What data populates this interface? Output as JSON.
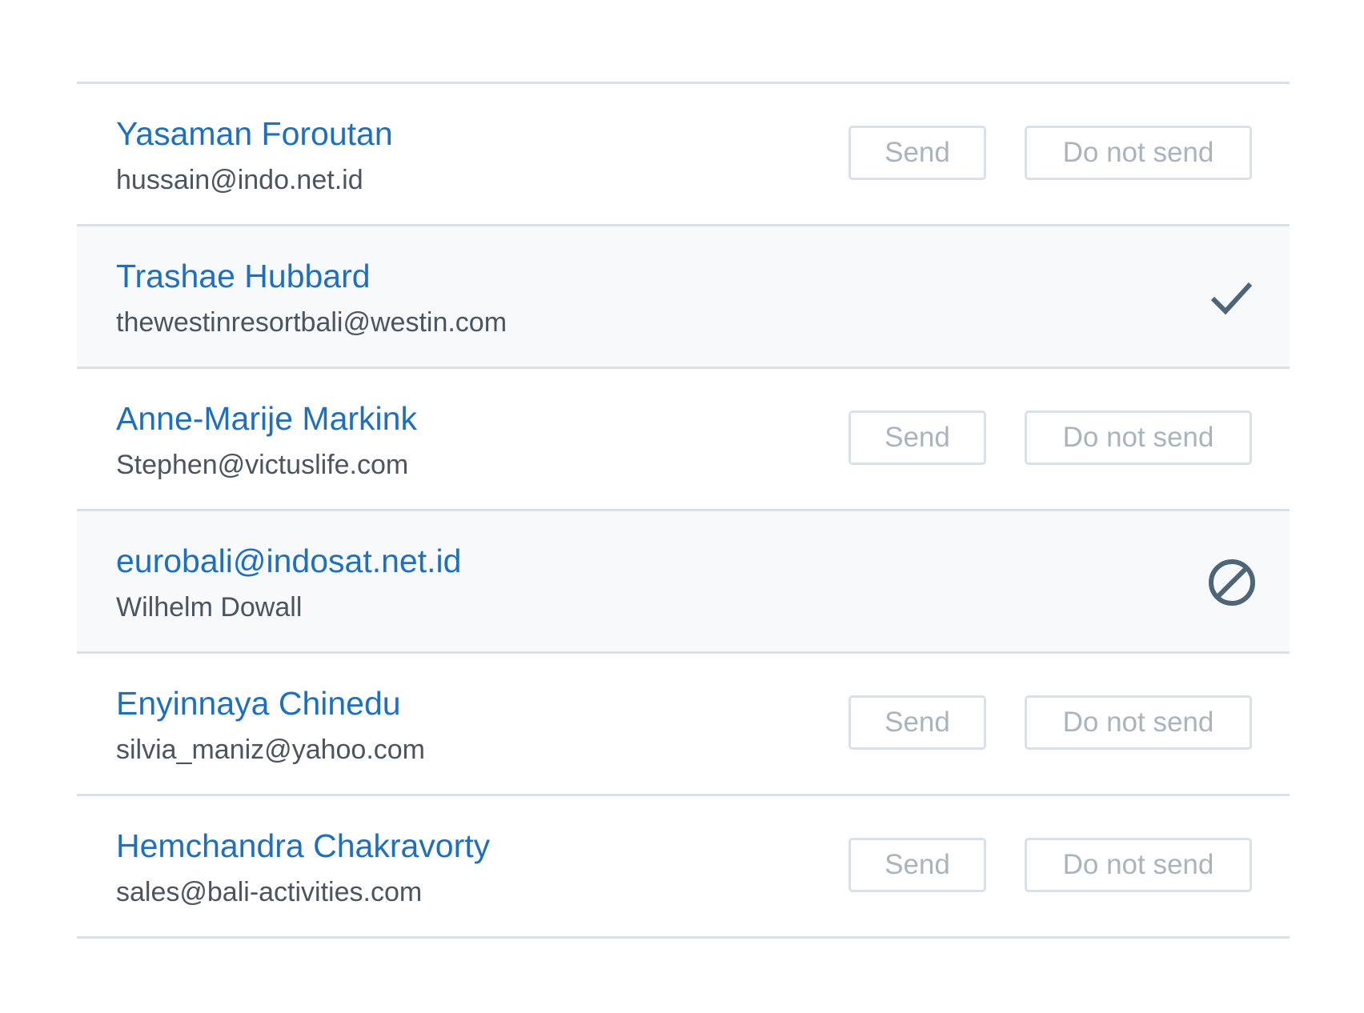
{
  "colors": {
    "name": "#1f6fbf",
    "subtext": "#4a5560",
    "divider": "#d8e1e8",
    "button_text": "#a9b4bd",
    "status_icon": "#4e6577",
    "resolved_row_bg": "#f7f9fb"
  },
  "rows": [
    {
      "primary": "Yasaman Foroutan",
      "secondary": "hussain@indo.net.id",
      "send_label": "Send",
      "no_send_label": "Do not send"
    },
    {
      "primary": "Trashae Hubbard",
      "secondary": "thewestinresortbali@westin.com",
      "status_icon": "checkmark-icon"
    },
    {
      "primary": "Anne-Marije Markink",
      "secondary": "Stephen@victuslife.com",
      "send_label": "Send",
      "no_send_label": "Do not send"
    },
    {
      "primary": "eurobali@indosat.net.id",
      "secondary": "Wilhelm Dowall",
      "status_icon": "prohibited-icon"
    },
    {
      "primary": "Enyinnaya Chinedu",
      "secondary": "silvia_maniz@yahoo.com",
      "send_label": "Send",
      "no_send_label": "Do not send"
    },
    {
      "primary": "Hemchandra Chakravorty",
      "secondary": "sales@bali-activities.com",
      "send_label": "Send",
      "no_send_label": "Do not send"
    }
  ]
}
